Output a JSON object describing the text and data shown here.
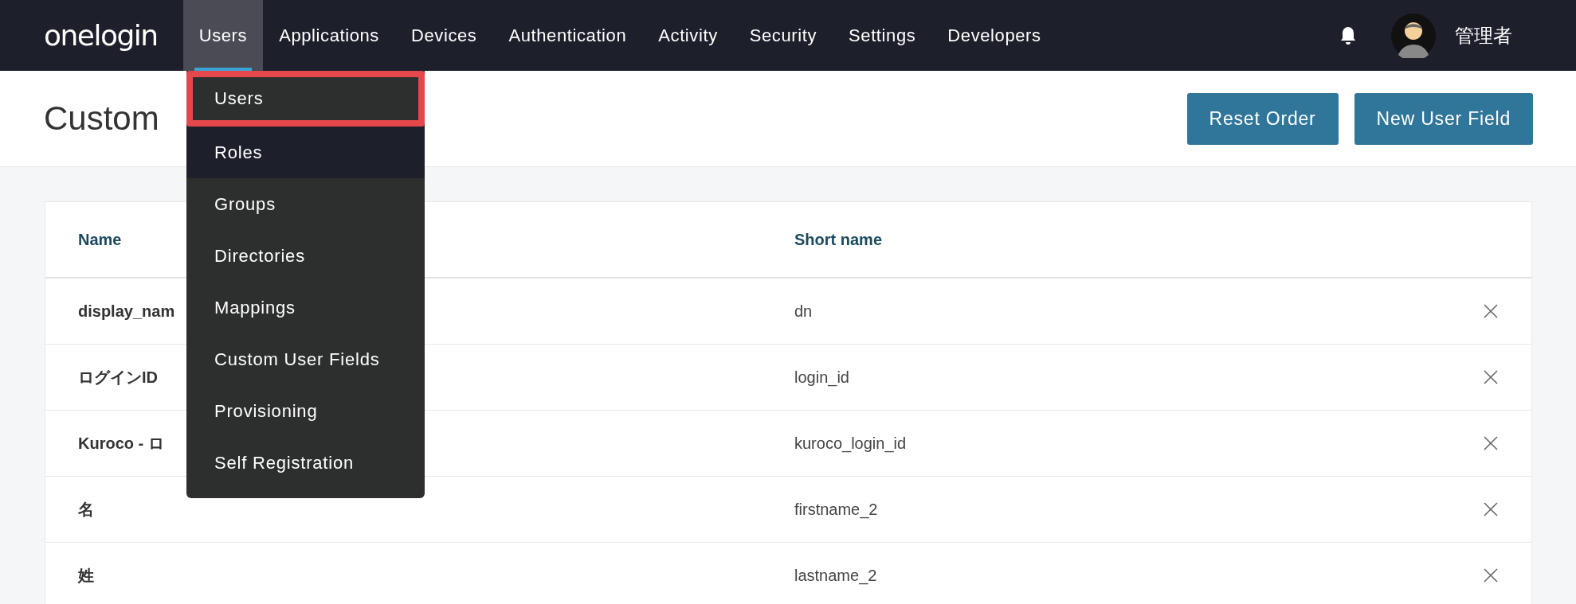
{
  "nav": {
    "logo": "onelogin",
    "tabs": [
      {
        "label": "Users",
        "selected": true
      },
      {
        "label": "Applications",
        "selected": false
      },
      {
        "label": "Devices",
        "selected": false
      },
      {
        "label": "Authentication",
        "selected": false
      },
      {
        "label": "Activity",
        "selected": false
      },
      {
        "label": "Security",
        "selected": false
      },
      {
        "label": "Settings",
        "selected": false
      },
      {
        "label": "Developers",
        "selected": false
      }
    ],
    "user_name": "管理者"
  },
  "users_menu": {
    "items": [
      {
        "label": "Users",
        "selected": true,
        "hovered": false
      },
      {
        "label": "Roles",
        "selected": false,
        "hovered": true
      },
      {
        "label": "Groups",
        "selected": false,
        "hovered": false
      },
      {
        "label": "Directories",
        "selected": false,
        "hovered": false
      },
      {
        "label": "Mappings",
        "selected": false,
        "hovered": false
      },
      {
        "label": "Custom User Fields",
        "selected": false,
        "hovered": false
      },
      {
        "label": "Provisioning",
        "selected": false,
        "hovered": false
      },
      {
        "label": "Self Registration",
        "selected": false,
        "hovered": false
      }
    ]
  },
  "page": {
    "title": "Custom",
    "buttons": [
      "Reset Order",
      "New User Field"
    ]
  },
  "table": {
    "columns": [
      "Name",
      "Short name"
    ],
    "rows": [
      {
        "name": "display_nam",
        "short_name": "dn"
      },
      {
        "name": "ログインID",
        "short_name": "login_id"
      },
      {
        "name": "Kuroco - ロ",
        "short_name": "kuroco_login_id"
      },
      {
        "name": "名",
        "short_name": "firstname_2"
      },
      {
        "name": "姓",
        "short_name": "lastname_2"
      }
    ]
  }
}
